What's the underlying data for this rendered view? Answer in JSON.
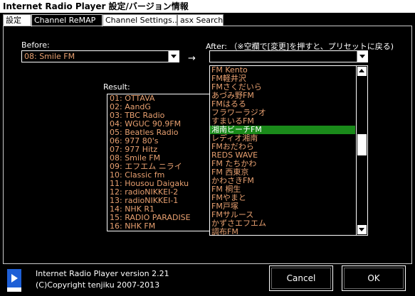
{
  "window": {
    "title": "Internet Radio Player 設定/バージョン情報"
  },
  "tabs": [
    "設定",
    "Channel ReMAP",
    "Channel Settings...",
    "asx Search"
  ],
  "before": {
    "label": "Before:",
    "value": "08: Smile FM"
  },
  "arrow": "→",
  "after": {
    "label": "After: （※空欄で[変更]を押すと、プリセットに戻る)",
    "value": ""
  },
  "result": {
    "label": "Result:",
    "items": [
      "01: OTTAVA",
      "02: AandG",
      "03: TBC Radio",
      "04: WGUC 90.9FM",
      "05: Beatles Radio",
      "06: 977 80's",
      "07: 977 Hitz",
      "08: Smile FM",
      "09: エフエム ニライ",
      "10: Classic fm",
      "11: Housou Daigaku",
      "12: radioNIKKEI-2",
      "13: radioNIKKEI-1",
      "14: NHK R1",
      "15: RADIO PARADISE",
      "16: NHK FM"
    ]
  },
  "dropdown": {
    "items": [
      "FM Kento",
      "FM軽井沢",
      "FMさくだいら",
      "あづみ野FM",
      "FMはるる",
      "フラワーラジオ",
      "すまいるFM",
      "湘南ビーチFM",
      "レディオ湘南",
      "FMおだわら",
      "REDS WAVE",
      "FM たちかわ",
      "FM 西東京",
      "かわさきFM",
      "FM 桐生",
      "FMやまと",
      "FM戸塚",
      "FMサルース",
      "かずさエフエム",
      "調布FM"
    ],
    "selected_index": 7
  },
  "footer": {
    "version": "Internet Radio Player version 2.21",
    "copyright": "(C)Copyright tenjiku 2007-2013",
    "cancel_label": "Cancel",
    "ok_label": "OK"
  },
  "colors": {
    "item_text": "#e8a070",
    "selection": "#1a8a1a",
    "icon": "#1e5fd6"
  }
}
